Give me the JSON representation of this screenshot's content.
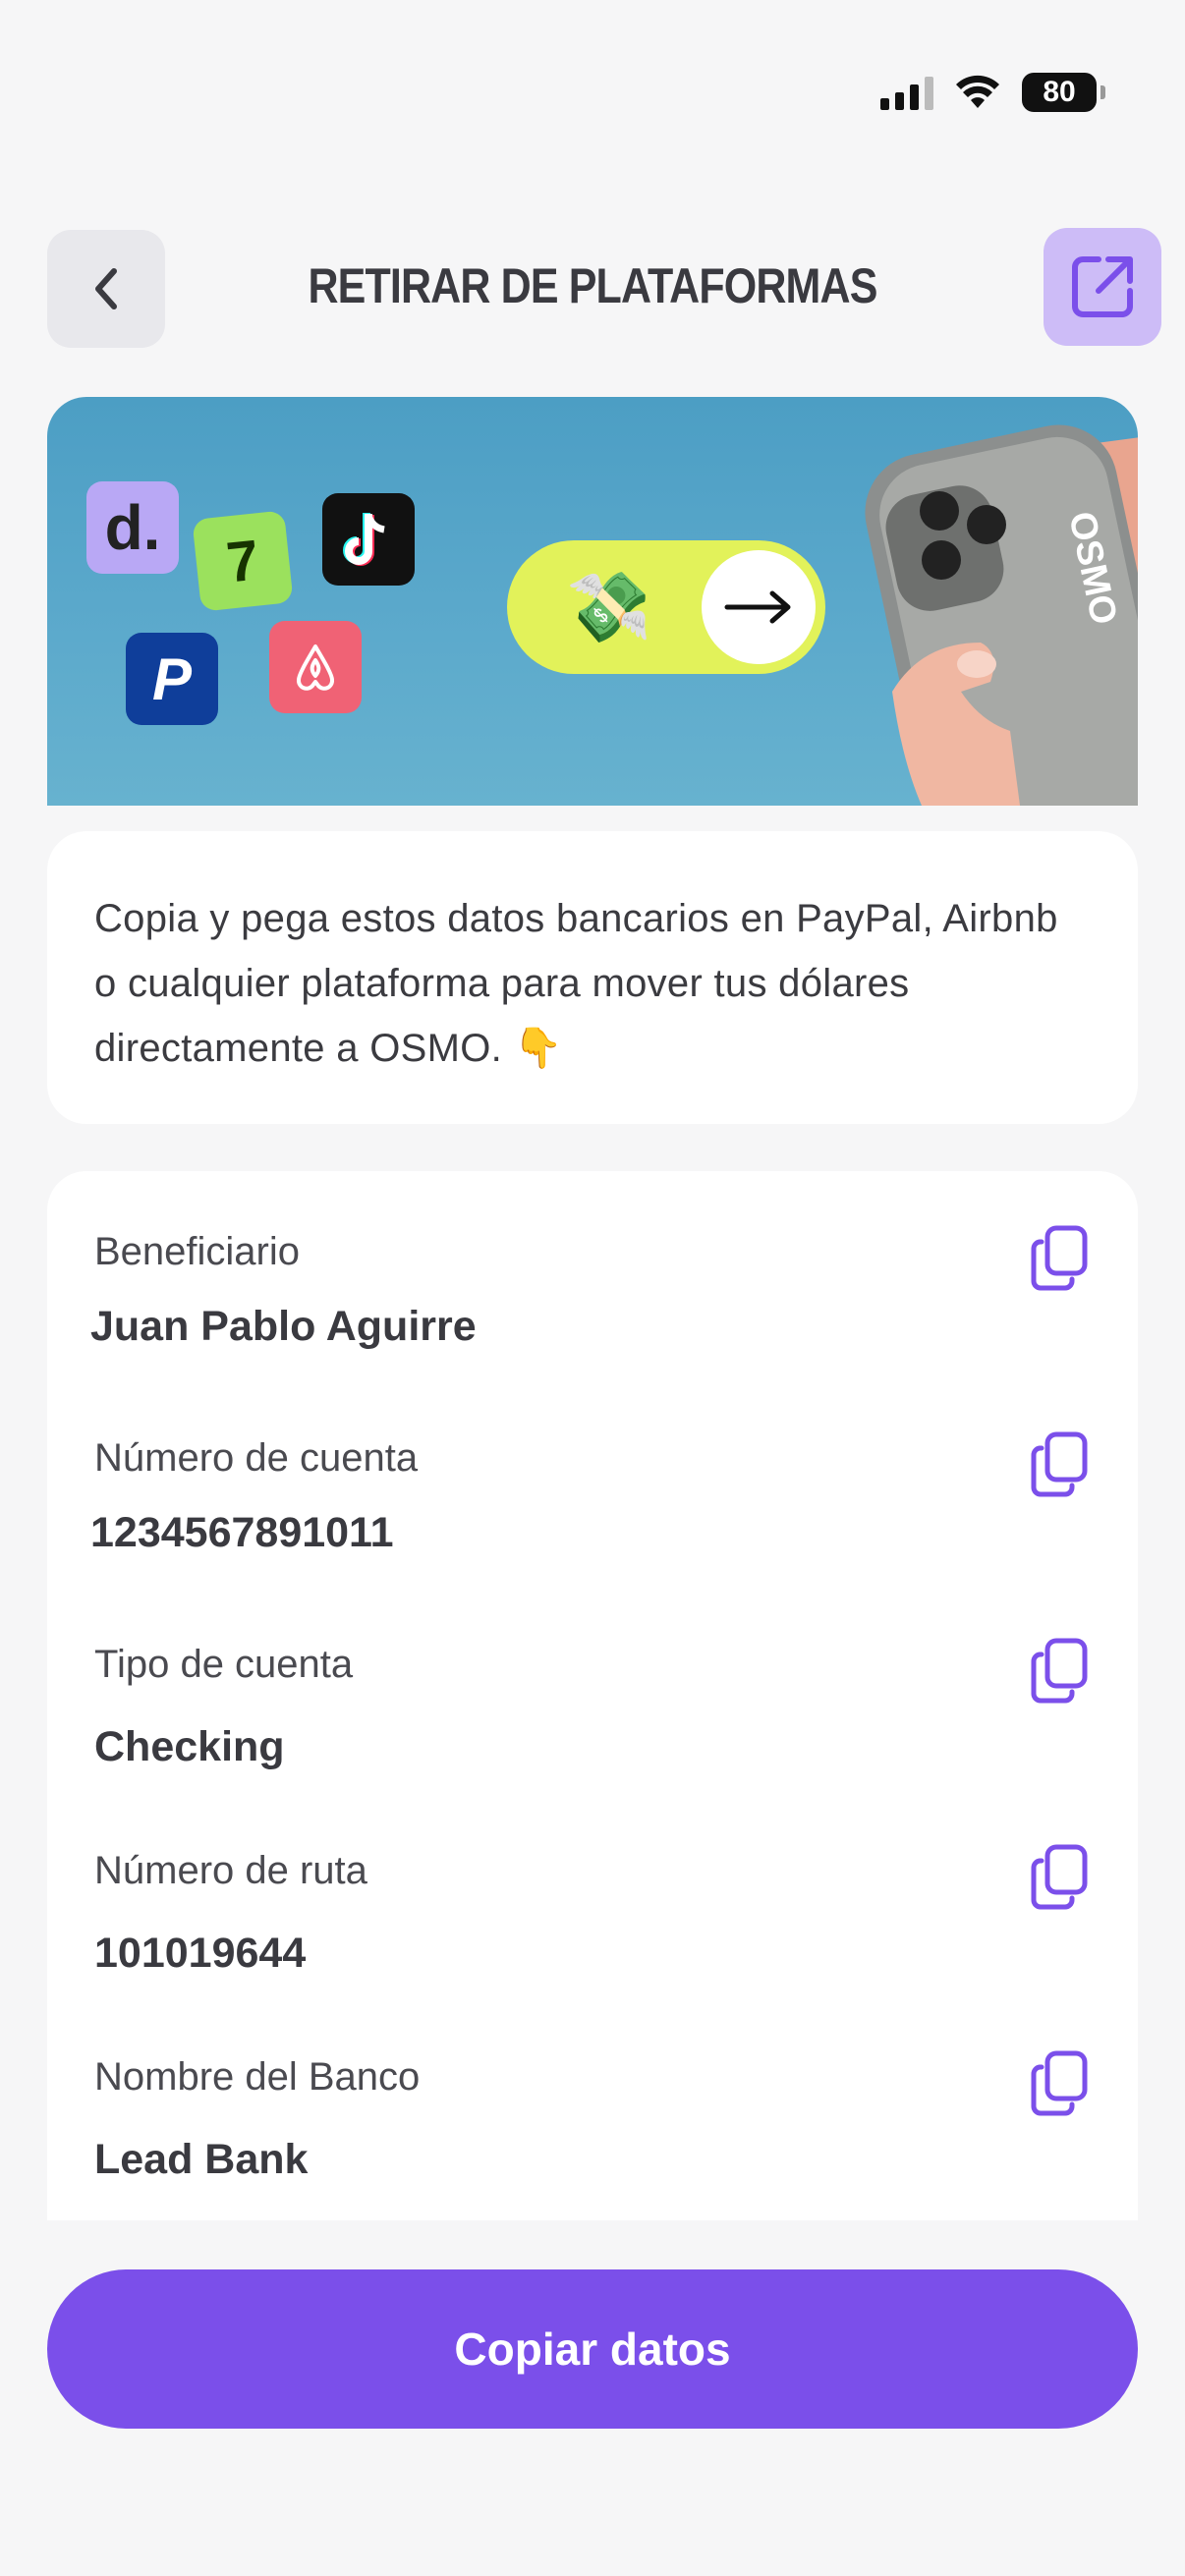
{
  "status_bar": {
    "battery": "80"
  },
  "header": {
    "title": "RETIRAR DE PLATAFORMAS"
  },
  "banner": {
    "apps": [
      "deel-icon",
      "wise-icon",
      "tiktok-icon",
      "paypal-icon",
      "airbnb-icon"
    ],
    "logo_text": "OSMO"
  },
  "info": {
    "text": "Copia y pega estos datos bancarios en PayPal, Airbnb o cualquier plataforma para mover tus dólares directamente a OSMO. 👇"
  },
  "details": [
    {
      "label": "Beneficiario",
      "value": "Juan Pablo Aguirre"
    },
    {
      "label": "Número de cuenta",
      "value": "1234567891011"
    },
    {
      "label": "Tipo de cuenta",
      "value": "Checking"
    },
    {
      "label": "Número de ruta",
      "value": "101019644"
    },
    {
      "label": "Nombre del Banco",
      "value": "Lead Bank"
    }
  ],
  "actions": {
    "copy_all": "Copiar datos"
  },
  "colors": {
    "accent": "#7B4FEA",
    "accent_light": "#CDBCF7",
    "pill": "#E2F25A"
  }
}
